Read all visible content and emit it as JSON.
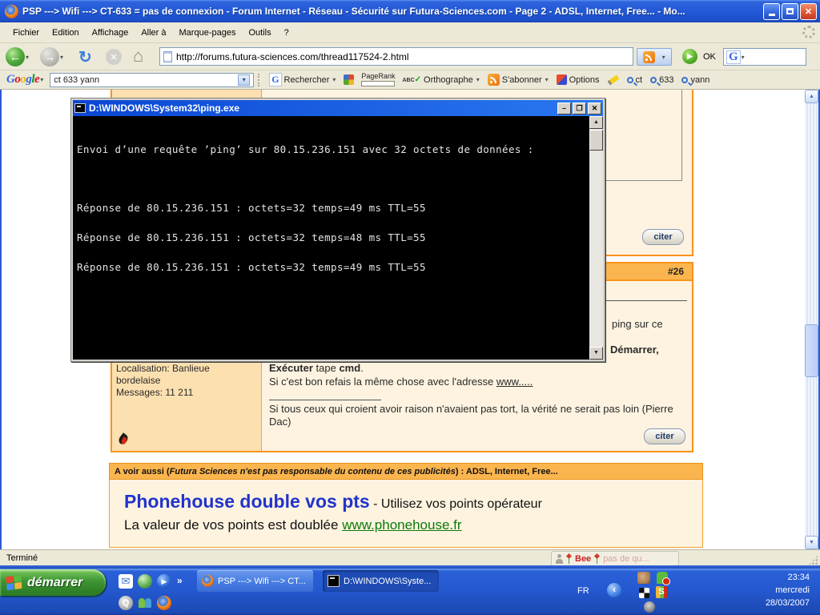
{
  "browser": {
    "title": "PSP ---> Wifi ---> CT-633 = pas de connexion - Forum Internet - Réseau - Sécurité sur Futura-Sciences.com - Page 2 - ADSL, Internet, Free... - Mo...",
    "menu": [
      "Fichier",
      "Edition",
      "Affichage",
      "Aller à",
      "Marque-pages",
      "Outils",
      "?"
    ],
    "url": "http://forums.futura-sciences.com/thread117524-2.html",
    "go_label": "OK",
    "status_text": "Terminé",
    "status_widget": {
      "bee": "Bee",
      "muted": "pas de qu..."
    }
  },
  "google_toolbar": {
    "logo_letters": [
      "G",
      "o",
      "o",
      "g",
      "l",
      "e"
    ],
    "query": "ct 633 yann",
    "search_label": "Rechercher",
    "pagerank_label": "PageRank",
    "spell_abc": "ABC",
    "spell_check": "✓",
    "spell_label": "Orthographe",
    "subscribe_label": "S'abonner",
    "options_label": "Options",
    "term_buttons": [
      "ct",
      "633",
      "yann"
    ]
  },
  "console": {
    "title": "D:\\WINDOWS\\System32\\ping.exe",
    "lines": [
      "Envoi d’une requête ’ping’ sur 80.15.236.151 avec 32 octets de données :",
      "",
      "Réponse de 80.15.236.151 : octets=32 temps=49 ms TTL=55",
      "Réponse de 80.15.236.151 : octets=32 temps=48 ms TTL=55",
      "Réponse de 80.15.236.151 : octets=32 temps=49 ms TTL=55"
    ]
  },
  "forum": {
    "post_prev": {
      "cite_label": "citer"
    },
    "post": {
      "number": "#26",
      "fragment_line1": "ping sur ce",
      "fragment_line2": "Démarrer,",
      "exec_bold1": "Exécuter",
      "exec_mid": " tape ",
      "exec_bold2": "cmd",
      "exec_end": ".",
      "line_refais": "Si c'est bon refais la même chose avec l'adresse ",
      "link_www": "www.....",
      "signature": "Si tous ceux qui croient avoir raison n'avaient pas tort, la vérité ne serait pas loin (Pierre Dac)",
      "user_location": "Localisation: Banlieue bordelaise",
      "user_messages": "Messages: 11 211",
      "cite_label": "citer"
    },
    "ad": {
      "header_pre": "A voir aussi (",
      "header_italic": "Futura Sciences n'est pas responsable du contenu de ces publicités",
      "header_post": ") : ADSL, Internet, Free...",
      "title": "Phonehouse double vos pts",
      "subtitle": " - Utilisez vos points opérateur",
      "line2": "La valeur de vos points est doublée ",
      "link": "www.phonehouse.fr"
    }
  },
  "taskbar": {
    "start_label": "démarrer",
    "buttons": [
      {
        "label": "PSP ---> Wifi ---> CT..."
      },
      {
        "label": "D:\\WINDOWS\\Syste..."
      }
    ],
    "language": "FR",
    "clock": {
      "time": "23:34",
      "day": "mercredi",
      "date": "28/03/2007"
    }
  },
  "icons": {
    "back": "←",
    "forward": "→",
    "reload": "↻",
    "stop": "✕",
    "home": "⌂",
    "dropdown": "▾",
    "play": "▶",
    "chevrons": "»",
    "close": "✕",
    "scroll_up": "▲",
    "scroll_down": "▼",
    "minimize": "–",
    "maximize": "❐",
    "collapse": "‹",
    "envelope": "✉",
    "g_letter": "G",
    "q_letter": "Q"
  }
}
